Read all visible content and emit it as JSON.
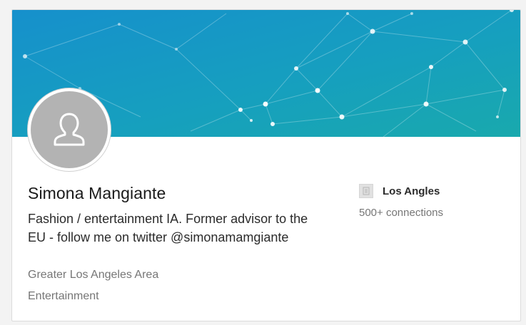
{
  "profile": {
    "name": "Simona Mangiante",
    "headline": "Fashion / entertainment IA. Former advisor to the EU - follow me on twitter @simonamamgiante",
    "location": "Greater Los Angeles Area",
    "industry": "Entertainment",
    "avatar_icon": "person-placeholder-icon"
  },
  "sidebar": {
    "company_name": "Los Angles",
    "company_icon": "building-icon",
    "connections": "500+ connections"
  },
  "colors": {
    "banner_left": "#1a93c9",
    "banner_right": "#1aa8b2",
    "avatar_bg": "#b3b3b3"
  }
}
